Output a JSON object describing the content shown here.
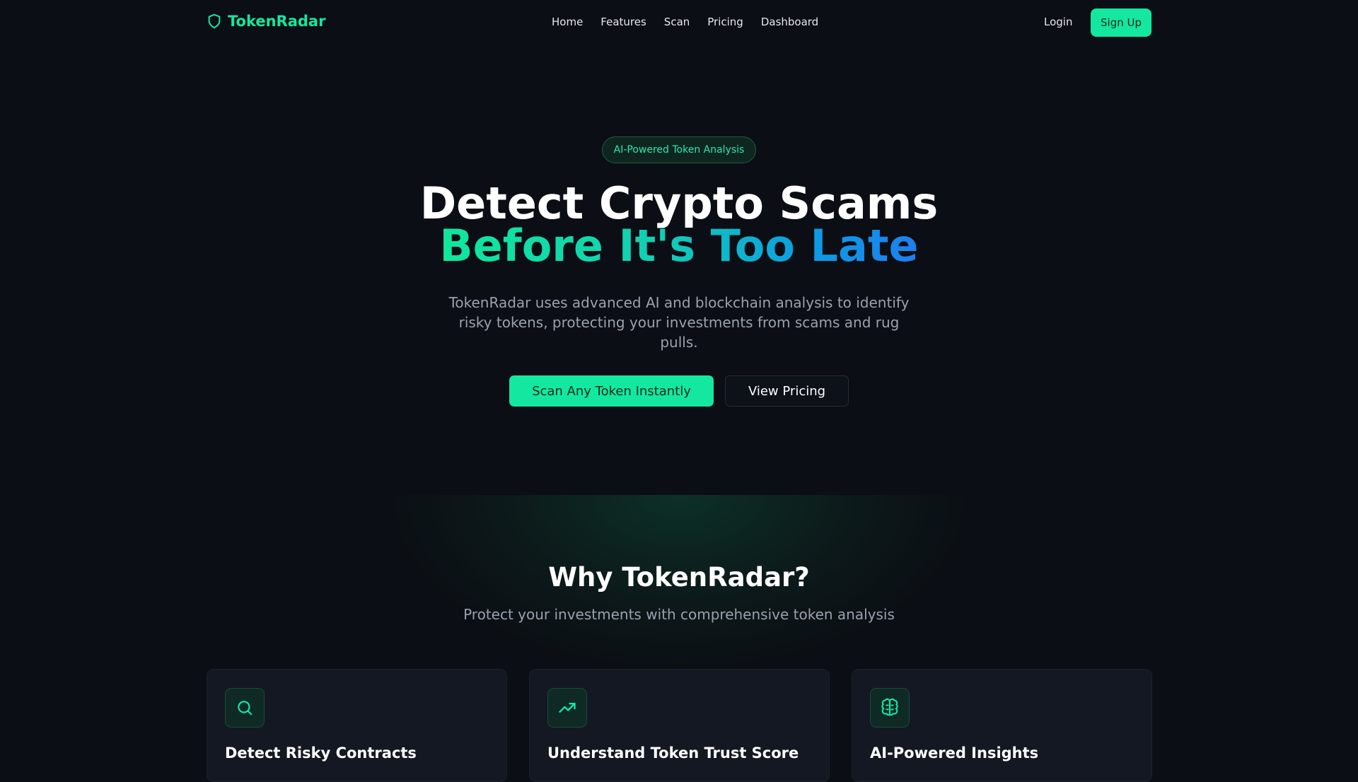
{
  "nav": {
    "brand": "TokenRadar",
    "links": [
      "Home",
      "Features",
      "Scan",
      "Pricing",
      "Dashboard"
    ],
    "login": "Login",
    "signup": "Sign Up"
  },
  "hero": {
    "badge": "AI-Powered Token Analysis",
    "title_line1": "Detect Crypto Scams",
    "title_line2": "Before It's Too Late",
    "subtitle": "TokenRadar uses advanced AI and blockchain analysis to identify risky tokens, protecting your investments from scams and rug pulls.",
    "cta_primary": "Scan Any Token Instantly",
    "cta_secondary": "View Pricing"
  },
  "features": {
    "title": "Why TokenRadar?",
    "subtitle": "Protect your investments with comprehensive token analysis",
    "cards": [
      {
        "icon": "search-icon",
        "title": "Detect Risky Contracts"
      },
      {
        "icon": "trending-up-icon",
        "title": "Understand Token Trust Score"
      },
      {
        "icon": "brain-icon",
        "title": "AI-Powered Insights"
      }
    ]
  },
  "colors": {
    "accent": "#14e8a0",
    "background": "#0b0e14",
    "gradient_end": "#1e7ff0"
  }
}
